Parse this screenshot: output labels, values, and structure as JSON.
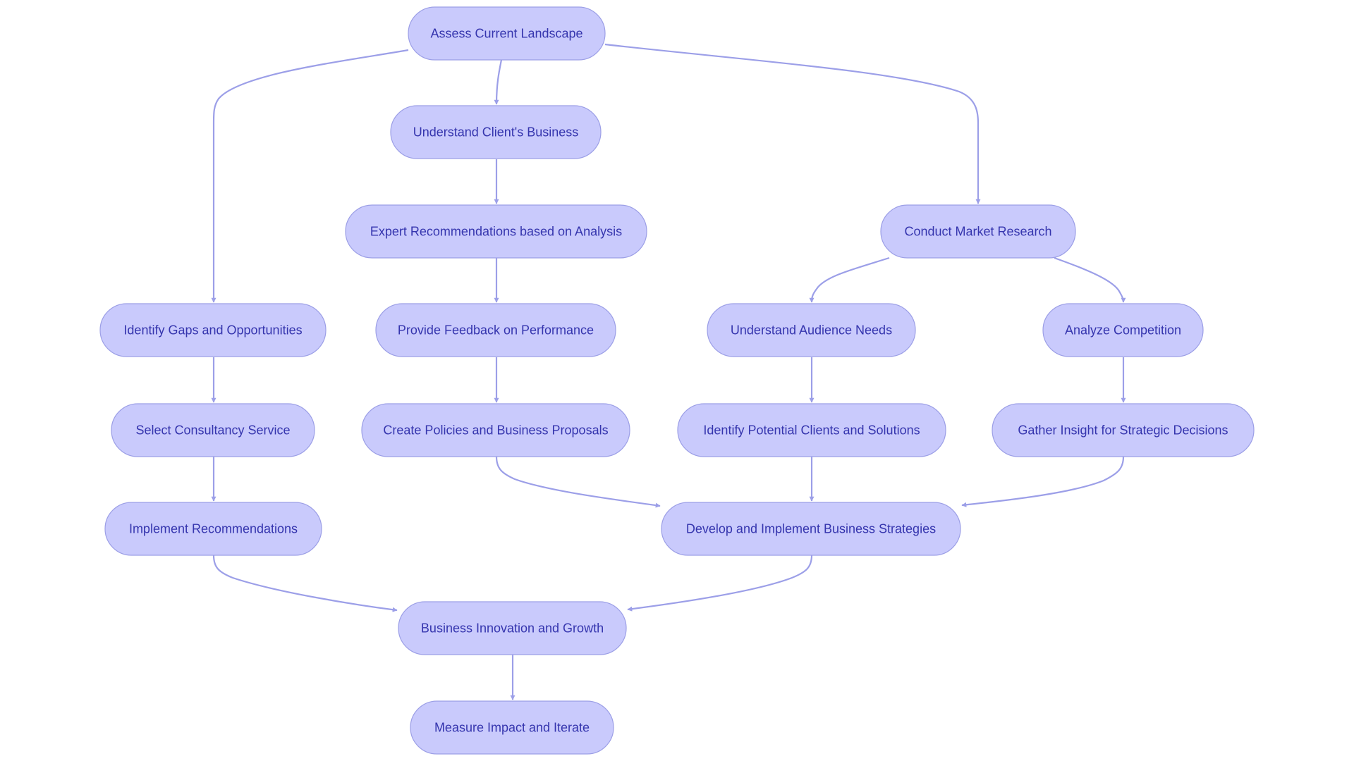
{
  "diagram": {
    "type": "flowchart",
    "direction": "top-down",
    "colors": {
      "node_fill": "#C9CAFC",
      "node_border": "#9C9FE6",
      "text": "#3535AE",
      "edge": "#9C9FE8"
    },
    "nodes": [
      {
        "id": "assess",
        "label": "Assess Current Landscape"
      },
      {
        "id": "client",
        "label": "Understand Client's Business"
      },
      {
        "id": "expert",
        "label": "Expert Recommendations based on Analysis"
      },
      {
        "id": "market",
        "label": "Conduct Market Research"
      },
      {
        "id": "gaps",
        "label": "Identify Gaps and Opportunities"
      },
      {
        "id": "feedback",
        "label": "Provide Feedback on Performance"
      },
      {
        "id": "audience",
        "label": "Understand Audience Needs"
      },
      {
        "id": "competition",
        "label": "Analyze Competition"
      },
      {
        "id": "select",
        "label": "Select Consultancy Service"
      },
      {
        "id": "policies",
        "label": "Create Policies and Business Proposals"
      },
      {
        "id": "potential",
        "label": "Identify Potential Clients and Solutions"
      },
      {
        "id": "insight",
        "label": "Gather Insight for Strategic Decisions"
      },
      {
        "id": "implement",
        "label": "Implement Recommendations"
      },
      {
        "id": "develop",
        "label": "Develop and Implement Business Strategies"
      },
      {
        "id": "growth",
        "label": "Business Innovation and Growth"
      },
      {
        "id": "measure",
        "label": "Measure Impact and Iterate"
      }
    ],
    "edges": [
      {
        "from": "assess",
        "to": "gaps"
      },
      {
        "from": "assess",
        "to": "client"
      },
      {
        "from": "assess",
        "to": "market"
      },
      {
        "from": "client",
        "to": "expert"
      },
      {
        "from": "expert",
        "to": "feedback"
      },
      {
        "from": "feedback",
        "to": "policies"
      },
      {
        "from": "gaps",
        "to": "select"
      },
      {
        "from": "select",
        "to": "implement"
      },
      {
        "from": "market",
        "to": "audience"
      },
      {
        "from": "market",
        "to": "competition"
      },
      {
        "from": "audience",
        "to": "potential"
      },
      {
        "from": "competition",
        "to": "insight"
      },
      {
        "from": "policies",
        "to": "develop"
      },
      {
        "from": "potential",
        "to": "develop"
      },
      {
        "from": "insight",
        "to": "develop"
      },
      {
        "from": "implement",
        "to": "growth"
      },
      {
        "from": "develop",
        "to": "growth"
      },
      {
        "from": "growth",
        "to": "measure"
      }
    ]
  }
}
